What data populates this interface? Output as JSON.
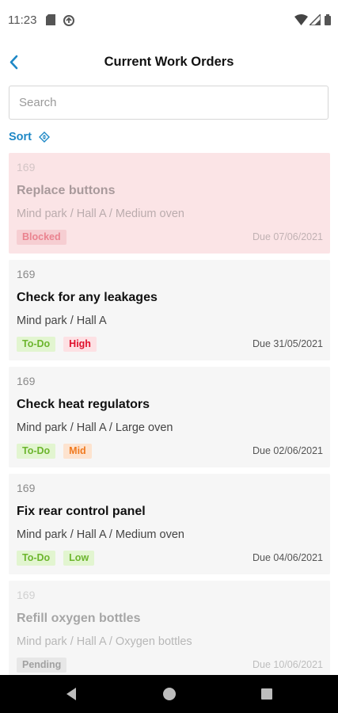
{
  "status_bar": {
    "time": "11:23",
    "icons": [
      "sd-card-icon",
      "data-saver-icon",
      "wifi-icon",
      "signal-icon",
      "battery-icon"
    ]
  },
  "header": {
    "title": "Current Work Orders",
    "back_icon": "chevron-left-icon"
  },
  "search": {
    "placeholder": "Search",
    "value": ""
  },
  "sort": {
    "label": "Sort",
    "icon": "sort-diamond-icon"
  },
  "work_orders": [
    {
      "id": "169",
      "title": "Replace buttons",
      "location": "Mind park / Hall A / Medium oven",
      "tags": [
        "Blocked"
      ],
      "due": "Due 07/06/2021"
    },
    {
      "id": "169",
      "title": "Check for any leakages",
      "location": "Mind park / Hall A",
      "tags": [
        "To-Do",
        "High"
      ],
      "due": "Due 31/05/2021"
    },
    {
      "id": "169",
      "title": "Check heat regulators",
      "location": "Mind park / Hall A / Large oven",
      "tags": [
        "To-Do",
        "Mid"
      ],
      "due": "Due 02/06/2021"
    },
    {
      "id": "169",
      "title": "Fix rear control panel",
      "location": "Mind park / Hall A / Medium oven",
      "tags": [
        "To-Do",
        "Low"
      ],
      "due": "Due 04/06/2021"
    },
    {
      "id": "169",
      "title": "Refill oxygen bottles",
      "location": "Mind park / Hall A / Oxygen bottles",
      "tags": [
        "Pending"
      ],
      "due": "Due 10/06/2021"
    }
  ],
  "colors": {
    "accent": "#1e88c6",
    "blocked_bg": "#fbe4e6",
    "card_bg": "#f6f6f6",
    "todo": "#6cb52d",
    "high": "#e0102c",
    "mid": "#f07a1f"
  },
  "nav_bar": {
    "icons": [
      "back-triangle-icon",
      "home-circle-icon",
      "recents-square-icon"
    ]
  }
}
